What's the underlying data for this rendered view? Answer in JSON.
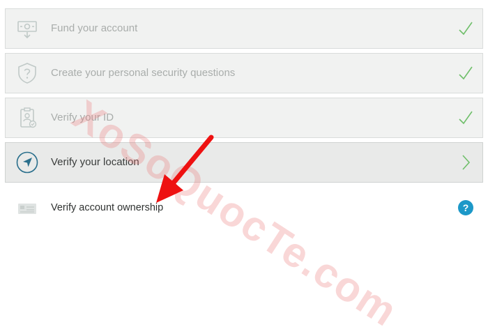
{
  "steps": [
    {
      "label": "Fund your account",
      "icon": "money-transfer-icon",
      "status": "check-icon",
      "state": "completed"
    },
    {
      "label": "Create your personal security questions",
      "icon": "shield-question-icon",
      "status": "check-icon",
      "state": "completed"
    },
    {
      "label": "Verify your ID",
      "icon": "id-badge-icon",
      "status": "check-icon",
      "state": "completed"
    },
    {
      "label": "Verify your location",
      "icon": "location-arrow-icon",
      "status": "chevron-right-icon",
      "state": "active"
    },
    {
      "label": "Verify account ownership",
      "icon": "card-icon",
      "status": "help-icon",
      "state": "current",
      "help_symbol": "?"
    }
  ],
  "watermark": "XoSoQuocTe.com",
  "colors": {
    "check": "#6fbf6a",
    "help": "#1c98c8",
    "muted": "#a9adab",
    "text": "#2f3231",
    "annotation_arrow": "#ee1111"
  }
}
